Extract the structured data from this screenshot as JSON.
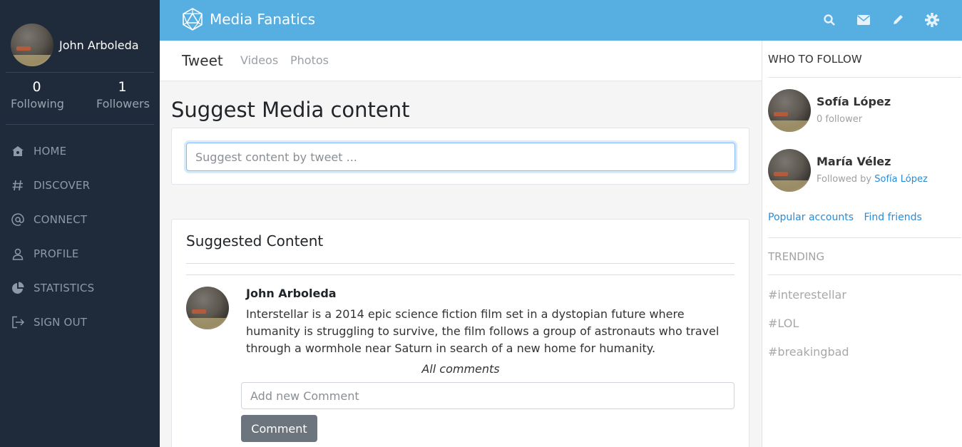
{
  "app": {
    "brand": "Media Fanatics"
  },
  "user": {
    "name": "John Arboleda",
    "following_count": "0",
    "following_label": "Following",
    "followers_count": "1",
    "followers_label": "Followers"
  },
  "nav": [
    {
      "label": "HOME",
      "icon": "home-icon"
    },
    {
      "label": "DISCOVER",
      "icon": "hash-icon"
    },
    {
      "label": "CONNECT",
      "icon": "at-icon"
    },
    {
      "label": "PROFILE",
      "icon": "person-icon"
    },
    {
      "label": "STATISTICS",
      "icon": "pie-chart-icon"
    },
    {
      "label": "SIGN OUT",
      "icon": "sign-out-icon"
    }
  ],
  "topbar": {
    "icons": [
      "search-icon",
      "envelope-icon",
      "pencil-icon",
      "gear-icon"
    ]
  },
  "tabs": [
    "Tweet",
    "Videos",
    "Photos"
  ],
  "compose": {
    "title": "Suggest Media content",
    "placeholder": "Suggest content by tweet ..."
  },
  "suggested": {
    "title": "Suggested Content",
    "post": {
      "author": "John Arboleda",
      "text": "Interstellar is a 2014 epic science fiction film set in a dystopian future where humanity is struggling to survive, the film follows a group of astronauts who travel through a wormhole near Saturn in search of a new home for humanity.",
      "comments_label": "All comments",
      "comment_placeholder": "Add new Comment",
      "comment_button": "Comment"
    }
  },
  "who_to_follow": {
    "title": "WHO TO FOLLOW",
    "people": [
      {
        "name": "Sofía López",
        "sub": "0 follower"
      },
      {
        "name": "María Vélez",
        "sub_prefix": "Followed by",
        "sub_link": "Sofía López"
      }
    ],
    "links": [
      "Popular accounts",
      "Find friends"
    ]
  },
  "trending": {
    "title": "TRENDING",
    "tags": [
      "#interestellar",
      "#LOL",
      "#breakingbad"
    ]
  },
  "colors": {
    "sidebar": "#1f2a3a",
    "topbar": "#57aee0",
    "link": "#2a8bd6"
  }
}
